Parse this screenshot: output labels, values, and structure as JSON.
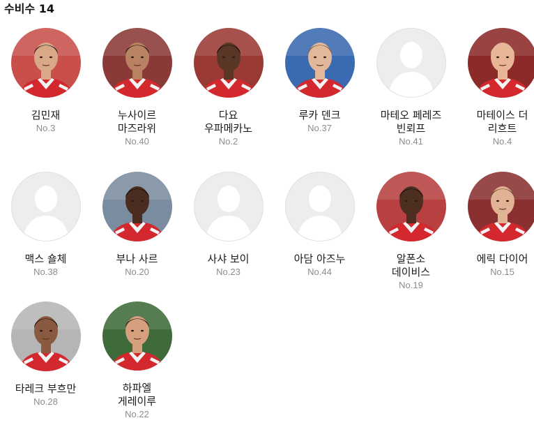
{
  "section": {
    "title": "수비수 14"
  },
  "players": [
    {
      "name": "김민재",
      "number": "No.3",
      "photo": true,
      "skin": "#d9a887",
      "hair": "#1c1c1c",
      "bg": "#c9504a"
    },
    {
      "name": "누사이르 마즈라위",
      "number": "No.40",
      "photo": true,
      "skin": "#b98363",
      "hair": "#1e1612",
      "bg": "#8a3a36"
    },
    {
      "name": "다요 우파메카노",
      "number": "No.2",
      "photo": true,
      "skin": "#5a3626",
      "hair": "#120c08",
      "bg": "#9a3a34"
    },
    {
      "name": "루카 덴크",
      "number": "No.37",
      "photo": true,
      "skin": "#e3b89a",
      "hair": "#7a5a3a",
      "bg": "#3a6ab0"
    },
    {
      "name": "마테오 페레즈 빈뢰프",
      "number": "No.41",
      "photo": false
    },
    {
      "name": "마테이스 더 리흐트",
      "number": "No.4",
      "photo": true,
      "skin": "#e8b597",
      "hair": "#d8c7a4",
      "bg": "#8c2a2a"
    },
    {
      "name": "맥스 숄체",
      "number": "No.38",
      "photo": false
    },
    {
      "name": "부나 사르",
      "number": "No.20",
      "photo": true,
      "skin": "#4a2c20",
      "hair": "#140c08",
      "bg": "#7a8ca0"
    },
    {
      "name": "사샤 보이",
      "number": "No.23",
      "photo": false
    },
    {
      "name": "아담 아즈누",
      "number": "No.44",
      "photo": false
    },
    {
      "name": "알폰소 데이비스",
      "number": "No.19",
      "photo": true,
      "skin": "#4d2f22",
      "hair": "#120b07",
      "bg": "#b84040"
    },
    {
      "name": "에릭 다이어",
      "number": "No.15",
      "photo": true,
      "skin": "#e2b294",
      "hair": "#6a4a30",
      "bg": "#8a3030"
    },
    {
      "name": "타레크 부흐만",
      "number": "No.28",
      "photo": true,
      "skin": "#8a5a40",
      "hair": "#1c1410",
      "bg": "#b5b5b5"
    },
    {
      "name": "하파엘 게레이루",
      "number": "No.22",
      "photo": true,
      "skin": "#d6a07e",
      "hair": "#2a1c12",
      "bg": "#3f6a3a"
    }
  ],
  "colors": {
    "jersey_red": "#d4282f",
    "jersey_white": "#f4f4f4",
    "placeholder_bg": "#ededed",
    "placeholder_silhouette": "#ffffff",
    "name_text": "#1a1a1a",
    "number_text": "#8c8c8c"
  }
}
